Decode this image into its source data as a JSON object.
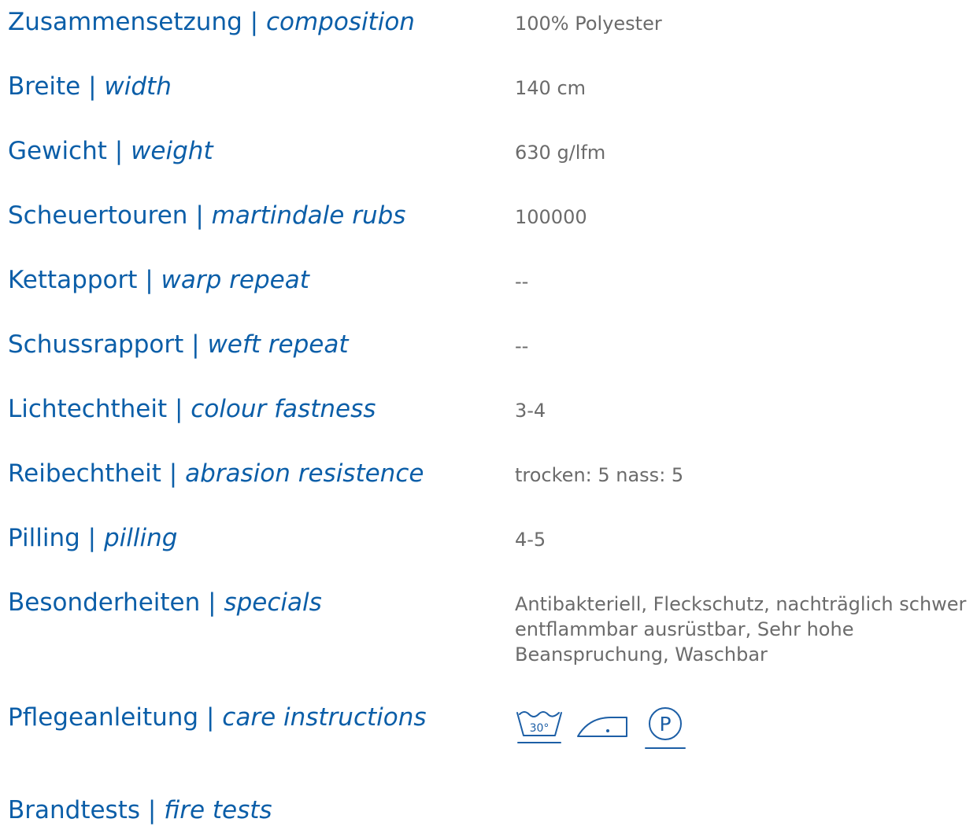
{
  "rows": [
    {
      "de": "Zusammensetzung",
      "sep": " | ",
      "en": "composition",
      "value": "100% Polyester"
    },
    {
      "de": "Breite",
      "sep": " | ",
      "en": "width",
      "value": "140 cm"
    },
    {
      "de": "Gewicht",
      "sep": " | ",
      "en": "weight",
      "value": "630 g/lfm"
    },
    {
      "de": "Scheuertouren",
      "sep": " | ",
      "en": "martindale rubs",
      "value": "100000"
    },
    {
      "de": "Kettapport",
      "sep": " | ",
      "en": "warp repeat",
      "value": "--"
    },
    {
      "de": "Schussrapport",
      "sep": " | ",
      "en": "weft repeat",
      "value": "--"
    },
    {
      "de": "Lichtechtheit",
      "sep": " | ",
      "en": "colour fastness",
      "value": "3-4"
    },
    {
      "de": "Reibechtheit",
      "sep": " | ",
      "en": "abrasion resistence",
      "value": "trocken: 5 nass: 5"
    },
    {
      "de": "Pilling",
      "sep": " | ",
      "en": "pilling",
      "value": "4-5"
    },
    {
      "de": "Besonderheiten",
      "sep": " | ",
      "en": "specials",
      "value": "Antibakteriell, Fleckschutz, nachträglich schwer entflammbar ausrüstbar, Sehr hohe Beanspruchung, Waschbar"
    },
    {
      "de": "Pflegeanleitung",
      "sep": " | ",
      "en": "care instructions",
      "icons": [
        "wash-30-icon",
        "iron-one-dot-icon",
        "professional-dry-clean-p-icon"
      ],
      "wash_temp": "30°",
      "dryclean_letter": "P"
    },
    {
      "de": "Brandtests",
      "sep": " | ",
      "en": "fire tests"
    }
  ],
  "colors": {
    "label": "#0b5ea8",
    "value": "#6b6b6b",
    "icon": "#1d5fa6"
  }
}
